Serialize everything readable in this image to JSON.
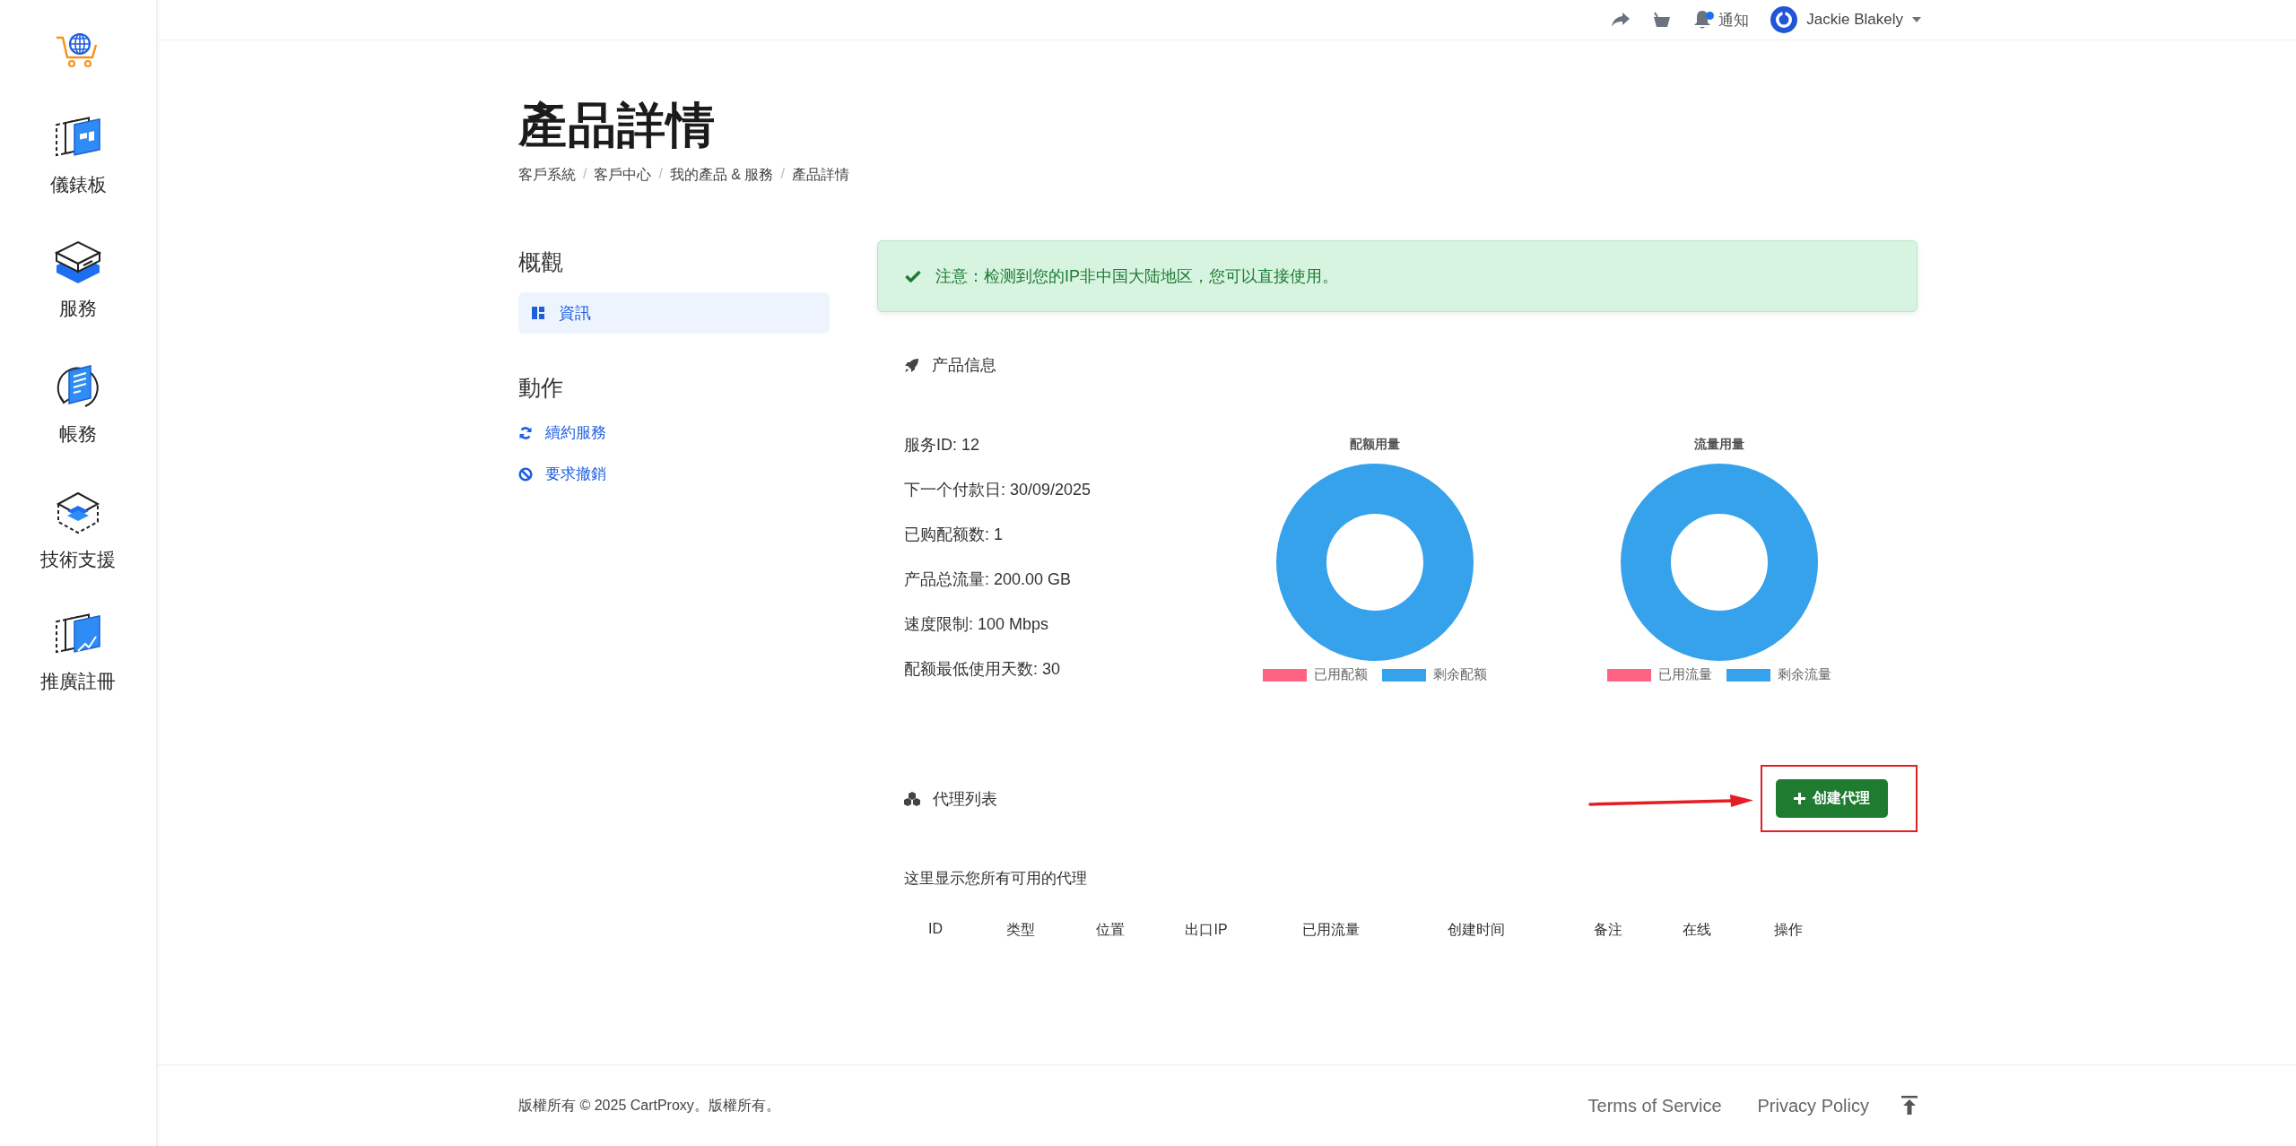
{
  "sidebar": {
    "items": [
      {
        "label": "儀錶板"
      },
      {
        "label": "服務"
      },
      {
        "label": "帳務"
      },
      {
        "label": "技術支援"
      },
      {
        "label": "推廣註冊"
      }
    ]
  },
  "topbar": {
    "notifications": {
      "label": "通知",
      "unread": true
    },
    "user": {
      "name": "Jackie Blakely"
    }
  },
  "page": {
    "title": "產品詳情",
    "breadcrumb": [
      "客戶系統",
      "客戶中心",
      "我的產品 & 服務",
      "產品詳情"
    ],
    "breadcrumb_separator": "/"
  },
  "side_menu": {
    "sections": [
      {
        "kind": "nav",
        "heading": "概觀",
        "items": [
          {
            "label": "資訊",
            "selected": true
          }
        ]
      },
      {
        "kind": "actions",
        "heading": "動作",
        "items": [
          {
            "label": "續約服務"
          },
          {
            "label": "要求撤銷"
          }
        ]
      }
    ]
  },
  "alert": {
    "kind": "success",
    "text": "注意：检测到您的IP非中国大陆地区，您可以直接使用。"
  },
  "product_info": {
    "heading": "产品信息",
    "details": [
      "服务ID: 12",
      "下一个付款日: 30/09/2025",
      "已购配额数: 1",
      "产品总流量: 200.00 GB",
      "速度限制: 100 Mbps",
      "配额最低使用天数: 30"
    ],
    "charts": [
      {
        "title": "配额用量",
        "legend": [
          {
            "label": "已用配额",
            "color": "#ff6384"
          },
          {
            "label": "剩余配额",
            "color": "#36a2eb"
          }
        ]
      },
      {
        "title": "流量用量",
        "legend": [
          {
            "label": "已用流量",
            "color": "#ff6384"
          },
          {
            "label": "剩余流量",
            "color": "#36a2eb"
          }
        ]
      }
    ]
  },
  "proxy_list": {
    "heading": "代理列表",
    "create_button": "创建代理",
    "annotations": [
      {
        "kind": "arrow"
      },
      {
        "kind": "frame"
      }
    ],
    "description": "这里显示您所有可用的代理",
    "columns": [
      "ID",
      "类型",
      "位置",
      "出口IP",
      "已用流量",
      "创建时间",
      "备注",
      "在线",
      "操作"
    ]
  },
  "footer": {
    "copyright": "版權所有 © 2025 CartProxy。版權所有。",
    "links": [
      "Terms of Service",
      "Privacy Policy"
    ]
  }
}
